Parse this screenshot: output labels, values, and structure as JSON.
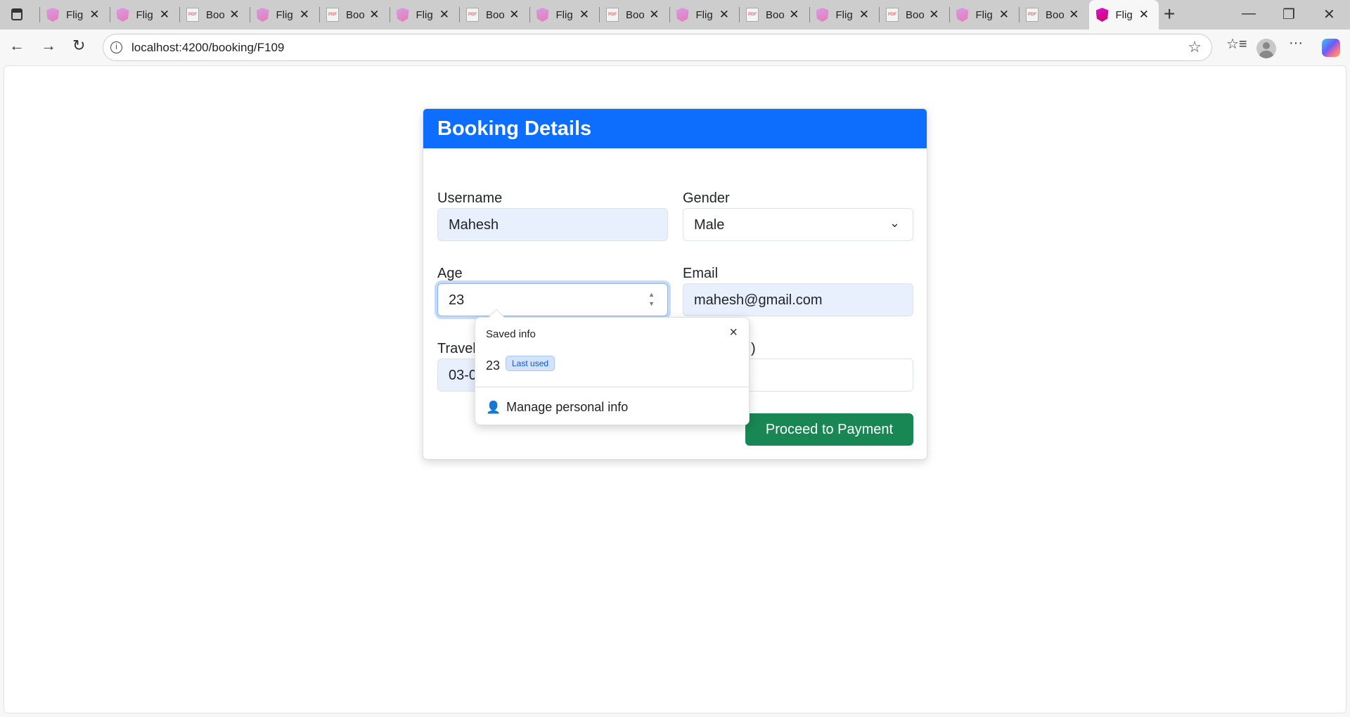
{
  "browser": {
    "tabs": [
      {
        "label": "Flig",
        "icon": "angular-icon"
      },
      {
        "label": "Flig",
        "icon": "angular-icon"
      },
      {
        "label": "Boo",
        "icon": "pdf-icon"
      },
      {
        "label": "Flig",
        "icon": "angular-icon"
      },
      {
        "label": "Boo",
        "icon": "pdf-icon"
      },
      {
        "label": "Flig",
        "icon": "angular-icon"
      },
      {
        "label": "Boo",
        "icon": "pdf-icon"
      },
      {
        "label": "Flig",
        "icon": "angular-icon"
      },
      {
        "label": "Boo",
        "icon": "pdf-icon"
      },
      {
        "label": "Flig",
        "icon": "angular-icon"
      },
      {
        "label": "Boo",
        "icon": "pdf-icon"
      },
      {
        "label": "Flig",
        "icon": "angular-icon"
      },
      {
        "label": "Boo",
        "icon": "pdf-icon"
      },
      {
        "label": "Flig",
        "icon": "angular-icon"
      },
      {
        "label": "Boo",
        "icon": "pdf-icon"
      },
      {
        "label": "Flig",
        "icon": "angular-icon",
        "active": true
      }
    ],
    "pdf_icon_text": "PDF",
    "url": "localhost:4200/booking/F109"
  },
  "card": {
    "title": "Booking Details",
    "header_color": "#0d6efd",
    "username": {
      "label": "Username",
      "value": "Mahesh"
    },
    "gender": {
      "label": "Gender",
      "value": "Male"
    },
    "age": {
      "label": "Age",
      "value": "23"
    },
    "email": {
      "label": "Email",
      "value": "mahesh@gmail.com"
    },
    "travel": {
      "label": "Travel",
      "value": "03-0"
    },
    "seats": {
      "label_visible": ")",
      "value": ""
    },
    "submit_label": "Proceed to Payment",
    "submit_color": "#198754"
  },
  "autofill": {
    "title": "Saved info",
    "value": "23",
    "badge": "Last used",
    "manage_label": "Manage personal info"
  }
}
